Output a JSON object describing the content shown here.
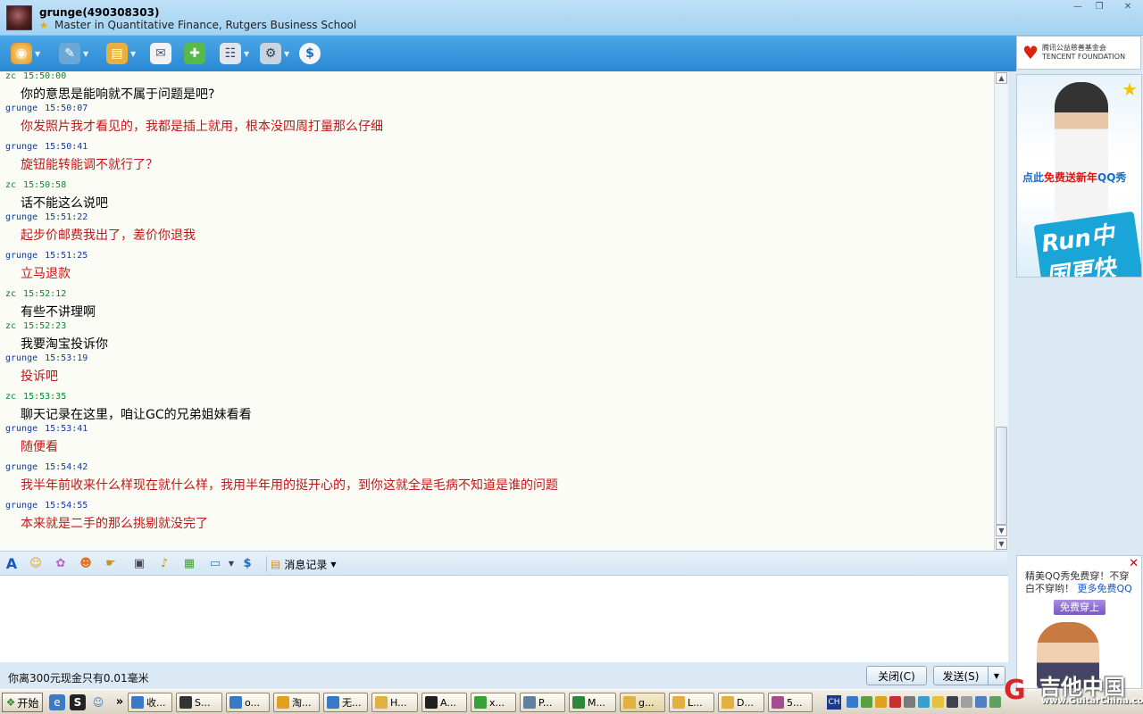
{
  "window": {
    "contact_name": "grunge(490308303)",
    "signature": "Master in Quantitative Finance, Rutgers Business School",
    "minimize": "—",
    "maximize": "❐",
    "close": "✕"
  },
  "toolbar": {
    "icons": [
      "video-call-icon",
      "voice-call-icon",
      "send-file-icon",
      "email-icon",
      "add-app-icon",
      "group-icon",
      "settings-icon",
      "tenpay-icon"
    ]
  },
  "messages": [
    {
      "sender": "zc",
      "time": "15:50:00",
      "text": "你的意思是能响就不属于问题是吧?"
    },
    {
      "sender": "grunge",
      "time": "15:50:07",
      "text": "你发照片我才看见的，我都是插上就用，根本没四周打量那么仔细"
    },
    {
      "sender": "grunge",
      "time": "15:50:41",
      "text": "旋钮能转能调不就行了？"
    },
    {
      "sender": "zc",
      "time": "15:50:58",
      "text": "话不能这么说吧"
    },
    {
      "sender": "grunge",
      "time": "15:51:22",
      "text": "起步价邮费我出了，差价你退我"
    },
    {
      "sender": "grunge",
      "time": "15:51:25",
      "text": "立马退款"
    },
    {
      "sender": "zc",
      "time": "15:52:12",
      "text": "有些不讲理啊"
    },
    {
      "sender": "zc",
      "time": "15:52:23",
      "text": "我要淘宝投诉你"
    },
    {
      "sender": "grunge",
      "time": "15:53:19",
      "text": "投诉吧"
    },
    {
      "sender": "zc",
      "time": "15:53:35",
      "text": "聊天记录在这里，咱让GC的兄弟姐妹看看"
    },
    {
      "sender": "grunge",
      "time": "15:53:41",
      "text": "随便看"
    },
    {
      "sender": "grunge",
      "time": "15:54:42",
      "text": "我半年前收来什么样现在就什么样，我用半年用的挺开心的，到你这就全是毛病不知道是谁的问题"
    },
    {
      "sender": "grunge",
      "time": "15:54:55",
      "text": "本来就是二手的那么挑剔就没完了"
    }
  ],
  "ad_top": {
    "logo_line1": "腾讯公益慈善基金会",
    "logo_line2": "TENCENT FOUNDATION",
    "caption_prefix": "点此",
    "caption_red": "免费送新年",
    "caption_suffix": "QQ秀",
    "run_text": "Run中国更快乐"
  },
  "input_toolbar": {
    "history_label": "消息记录"
  },
  "status": {
    "text": "你离300元现金只有0.01毫米"
  },
  "buttons": {
    "close_label": "关闭(C)",
    "send_label": "发送(S)"
  },
  "ad_bottom": {
    "text": "精美QQ秀免费穿！不穿白不穿哟！",
    "link": "更多免费QQ",
    "button": "免费穿上"
  },
  "taskbar": {
    "start_label": "开始",
    "tasks": [
      "收...",
      "S...",
      "o...",
      "淘...",
      "无...",
      "H...",
      "A...",
      "x...",
      "P...",
      "M...",
      "g...",
      "L...",
      "D...",
      "5..."
    ],
    "tray_lang": "CH"
  },
  "watermark": {
    "title": "吉他中国",
    "url": "www.GuitarChina.com"
  },
  "colors": {
    "zc_header": "#008a2c",
    "grunge_header": "#0e3aa0",
    "grunge_text": "#c01818",
    "toolbar_blue": "#2b89d4"
  }
}
